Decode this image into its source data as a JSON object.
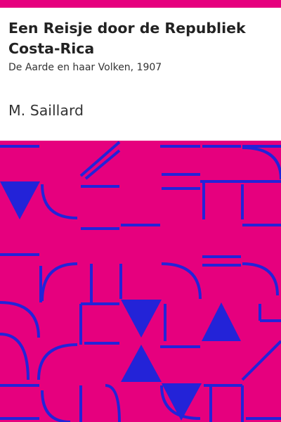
{
  "cover": {
    "title": "Een Reisje door de Republiek Costa-Rica",
    "subtitle": "De Aarde en haar Volken, 1907",
    "author": "M. Saillard"
  },
  "colors": {
    "accent": "#e6007e",
    "pattern_stroke": "#2323d8",
    "background": "#ffffff",
    "text": "#222222"
  }
}
